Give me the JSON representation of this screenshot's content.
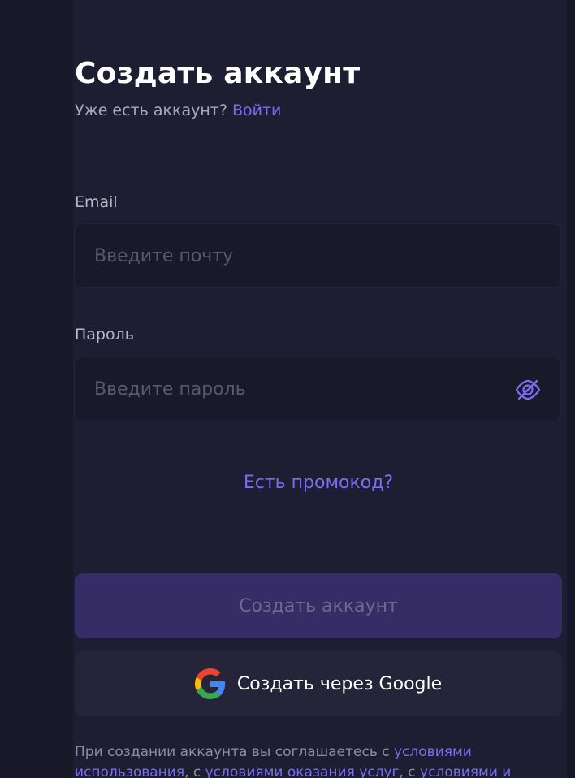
{
  "form": {
    "title": "Создать аккаунт",
    "subtitle_prefix": "Уже есть аккаунт?",
    "login_link": "Войти",
    "email_label": "Email",
    "email_placeholder": "Введите почту",
    "email_value": "",
    "password_label": "Пароль",
    "password_placeholder": "Введите пароль",
    "password_value": "",
    "password_toggle_icon": "eye-off-icon",
    "promo_link": "Есть промокод?",
    "submit_label": "Создать аккаунт",
    "google_label": "Создать через Google",
    "google_icon": "google-icon",
    "terms_prefix": "При создании аккаунта вы соглашаетесь с",
    "terms_link_1": "условиями использования",
    "terms_sep_1": ", с",
    "terms_link_2": "условиями оказания услуг",
    "terms_sep_2": ", с",
    "terms_link_3": "условиями и"
  },
  "colors": {
    "background": "#181828",
    "panel": "#1e1e33",
    "accent": "#7c6cf2",
    "input_bg": "#191929",
    "primary_disabled_bg": "#362d67",
    "primary_disabled_text": "#6f6a8b",
    "secondary_button_bg": "#252438",
    "google_blue": "#4285F4",
    "google_red": "#EA4335",
    "google_yellow": "#FBBC05",
    "google_green": "#34A853"
  }
}
